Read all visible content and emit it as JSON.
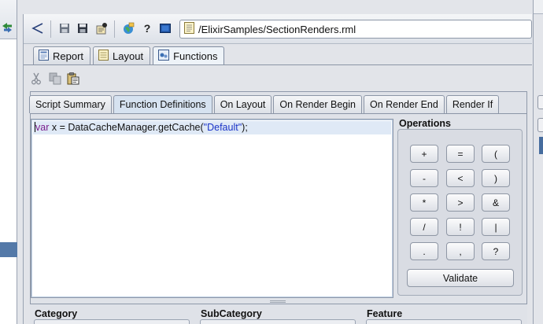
{
  "toolbar": {
    "icons": [
      "back-arrow-icon",
      "save-icon",
      "save-as-icon",
      "properties-icon",
      "globe-icon",
      "help-icon",
      "preview-icon"
    ],
    "help_label": "?",
    "path": "/ElixirSamples/SectionRenders.rml"
  },
  "view_tabs": [
    {
      "label": "Report",
      "icon": "report-icon"
    },
    {
      "label": "Layout",
      "icon": "layout-icon"
    },
    {
      "label": "Functions",
      "icon": "functions-icon",
      "active": true
    }
  ],
  "edit_tools": [
    "cut-icon",
    "copy-icon",
    "paste-icon"
  ],
  "section_tabs": [
    {
      "label": "Script Summary"
    },
    {
      "label": "Function Definitions",
      "active": true
    },
    {
      "label": "On Layout"
    },
    {
      "label": "On Render Begin"
    },
    {
      "label": "On Render End"
    },
    {
      "label": "Render If"
    }
  ],
  "editor": {
    "keyword": "var",
    "code_mid": " x = DataCacheManager.getCache(",
    "string": "\"Default\"",
    "code_end": ");"
  },
  "operations": {
    "title": "Operations",
    "buttons": [
      "+",
      "=",
      "(",
      "-",
      "<",
      ")",
      "*",
      ">",
      "&",
      "/",
      "!",
      "|",
      ".",
      ",",
      "?"
    ],
    "validate_label": "Validate"
  },
  "bottom": {
    "category": "Category",
    "subcategory": "SubCategory",
    "feature": "Feature"
  },
  "colors": {
    "keyword": "#7a1e8c",
    "string": "#1a33c7",
    "selection": "#466c9e"
  }
}
